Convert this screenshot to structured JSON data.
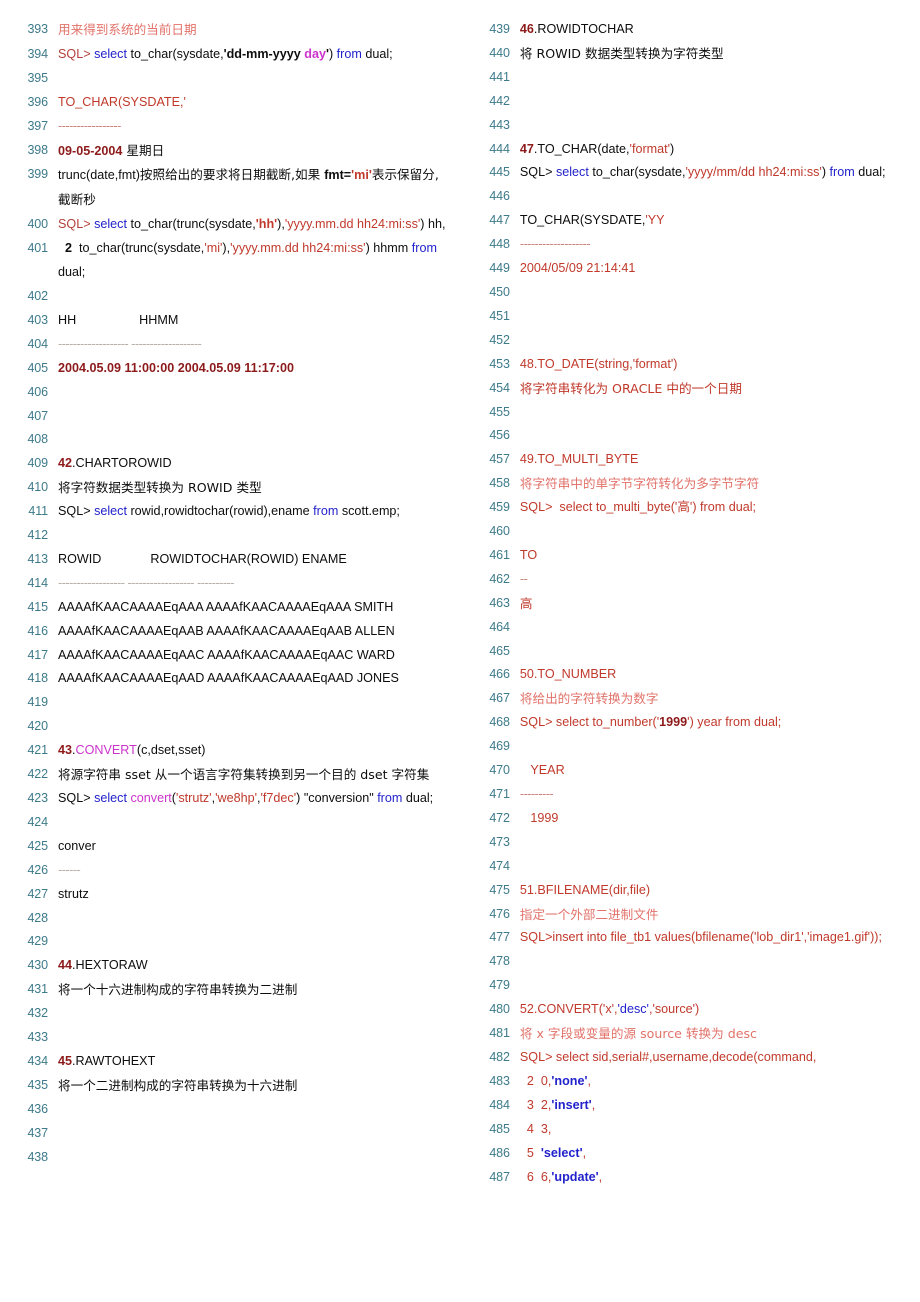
{
  "document": {
    "title": "Oracle 函数说明 (第 393-487 行)",
    "line_number_color": "#3d7a8a",
    "accent_red": "#c0392b",
    "accent_blue": "#2222cc",
    "accent_magenta": "#cc33cc"
  },
  "left_column": [
    {
      "n": "393",
      "text": "用来得到系统的当前日期"
    },
    {
      "n": "394",
      "text": "SQL> select to_char(sysdate,'dd-mm-yyyy day') from dual;"
    },
    {
      "n": "395",
      "text": ""
    },
    {
      "n": "396",
      "text": "TO_CHAR(SYSDATE,'"
    },
    {
      "n": "397",
      "text": "-----------------"
    },
    {
      "n": "398",
      "text": "09-05-2004 星期日"
    },
    {
      "n": "399",
      "text": "trunc(date,fmt)按照给出的要求将日期截断,如果 fmt='mi'表示保留分,截断秒"
    },
    {
      "n": "400",
      "text": "SQL> select to_char(trunc(sysdate,'hh'),'yyyy.mm.dd hh24:mi:ss') hh,"
    },
    {
      "n": "401",
      "text": "  2  to_char(trunc(sysdate,'mi'),'yyyy.mm.dd hh24:mi:ss') hhmm from dual;"
    },
    {
      "n": "402",
      "text": ""
    },
    {
      "n": "403",
      "text": "HH                  HHMM"
    },
    {
      "n": "404",
      "text": "------------------- -------------------"
    },
    {
      "n": "405",
      "text": "2004.05.09 11:00:00 2004.05.09 11:17:00"
    },
    {
      "n": "406",
      "text": ""
    },
    {
      "n": "407",
      "text": ""
    },
    {
      "n": "408",
      "text": ""
    },
    {
      "n": "409",
      "text": "42.CHARTOROWID"
    },
    {
      "n": "410",
      "text": "将字符数据类型转换为 ROWID 类型"
    },
    {
      "n": "411",
      "text": "SQL> select rowid,rowidtochar(rowid),ename from scott.emp;"
    },
    {
      "n": "412",
      "text": ""
    },
    {
      "n": "413",
      "text": "ROWID              ROWIDTOCHAR(ROWID) ENAME"
    },
    {
      "n": "414",
      "text": "------------------ ------------------ ----------"
    },
    {
      "n": "415",
      "text": "AAAAfKAACAAAAEqAAA AAAAfKAACAAAAEqAAA SMITH"
    },
    {
      "n": "416",
      "text": "AAAAfKAACAAAAEqAAB AAAAfKAACAAAAEqAAB ALLEN"
    },
    {
      "n": "417",
      "text": "AAAAfKAACAAAAEqAAC AAAAfKAACAAAAEqAAC WARD"
    },
    {
      "n": "418",
      "text": "AAAAfKAACAAAAEqAAD AAAAfKAACAAAAEqAAD JONES"
    },
    {
      "n": "419",
      "text": ""
    },
    {
      "n": "420",
      "text": ""
    },
    {
      "n": "421",
      "text": "43.CONVERT(c,dset,sset)"
    },
    {
      "n": "422",
      "text": "将源字符串 sset 从一个语言字符集转换到另一个目的 dset 字符集"
    },
    {
      "n": "423",
      "text": "SQL> select convert('strutz','we8hp','f7dec') \"conversion\" from dual;"
    },
    {
      "n": "424",
      "text": ""
    },
    {
      "n": "425",
      "text": "conver"
    },
    {
      "n": "426",
      "text": "------"
    },
    {
      "n": "427",
      "text": "strutz"
    },
    {
      "n": "428",
      "text": ""
    },
    {
      "n": "429",
      "text": ""
    },
    {
      "n": "430",
      "text": "44.HEXTORAW"
    },
    {
      "n": "431",
      "text": "将一个十六进制构成的字符串转换为二进制"
    },
    {
      "n": "432",
      "text": ""
    },
    {
      "n": "433",
      "text": ""
    },
    {
      "n": "434",
      "text": "45.RAWTOHEXT"
    },
    {
      "n": "435",
      "text": "将一个二进制构成的字符串转换为十六进制"
    },
    {
      "n": "436",
      "text": ""
    },
    {
      "n": "437",
      "text": ""
    },
    {
      "n": "438",
      "text": ""
    }
  ],
  "right_column": [
    {
      "n": "439",
      "text": "46.ROWIDTOCHAR"
    },
    {
      "n": "440",
      "text": "将 ROWID 数据类型转换为字符类型"
    },
    {
      "n": "441",
      "text": ""
    },
    {
      "n": "442",
      "text": ""
    },
    {
      "n": "443",
      "text": ""
    },
    {
      "n": "444",
      "text": "47.TO_CHAR(date,'format')"
    },
    {
      "n": "445",
      "text": "SQL> select to_char(sysdate,'yyyy/mm/dd hh24:mi:ss') from dual;"
    },
    {
      "n": "446",
      "text": ""
    },
    {
      "n": "447",
      "text": "TO_CHAR(SYSDATE,'YY"
    },
    {
      "n": "448",
      "text": "-------------------"
    },
    {
      "n": "449",
      "text": "2004/05/09 21:14:41"
    },
    {
      "n": "450",
      "text": ""
    },
    {
      "n": "451",
      "text": ""
    },
    {
      "n": "452",
      "text": ""
    },
    {
      "n": "453",
      "text": "48.TO_DATE(string,'format')"
    },
    {
      "n": "454",
      "text": "将字符串转化为 ORACLE 中的一个日期"
    },
    {
      "n": "455",
      "text": ""
    },
    {
      "n": "456",
      "text": ""
    },
    {
      "n": "457",
      "text": "49.TO_MULTI_BYTE"
    },
    {
      "n": "458",
      "text": "将字符串中的单字节字符转化为多字节字符"
    },
    {
      "n": "459",
      "text": "SQL>  select to_multi_byte('高') from dual;"
    },
    {
      "n": "460",
      "text": ""
    },
    {
      "n": "461",
      "text": "TO"
    },
    {
      "n": "462",
      "text": "--"
    },
    {
      "n": "463",
      "text": "高"
    },
    {
      "n": "464",
      "text": ""
    },
    {
      "n": "465",
      "text": ""
    },
    {
      "n": "466",
      "text": "50.TO_NUMBER"
    },
    {
      "n": "467",
      "text": "将给出的字符转换为数字"
    },
    {
      "n": "468",
      "text": "SQL> select to_number('1999') year from dual;"
    },
    {
      "n": "469",
      "text": ""
    },
    {
      "n": "470",
      "text": "   YEAR"
    },
    {
      "n": "471",
      "text": "---------"
    },
    {
      "n": "472",
      "text": "   1999"
    },
    {
      "n": "473",
      "text": ""
    },
    {
      "n": "474",
      "text": ""
    },
    {
      "n": "475",
      "text": "51.BFILENAME(dir,file)"
    },
    {
      "n": "476",
      "text": "指定一个外部二进制文件"
    },
    {
      "n": "477",
      "text": "SQL>insert into file_tb1 values(bfilename('lob_dir1','image1.gif'));"
    },
    {
      "n": "478",
      "text": ""
    },
    {
      "n": "479",
      "text": ""
    },
    {
      "n": "480",
      "text": "52.CONVERT('x','desc','source')"
    },
    {
      "n": "481",
      "text": "将 x 字段或变量的源 source 转换为 desc"
    },
    {
      "n": "482",
      "text": "SQL> select sid,serial#,username,decode(command,"
    },
    {
      "n": "483",
      "text": "  2  0,'none',"
    },
    {
      "n": "484",
      "text": "  3  2,'insert',"
    },
    {
      "n": "485",
      "text": "  4  3,"
    },
    {
      "n": "486",
      "text": "  5  'select',"
    },
    {
      "n": "487",
      "text": "  6  6,'update',"
    }
  ]
}
